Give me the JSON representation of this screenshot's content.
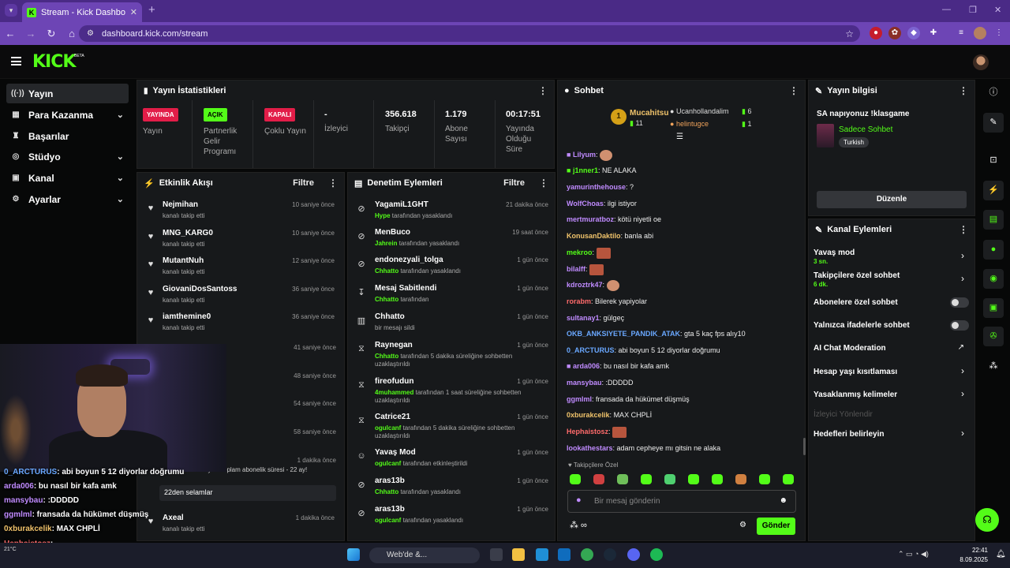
{
  "browser": {
    "tab_title": "Stream - Kick Dashboard",
    "url": "dashboard.kick.com/stream"
  },
  "header": {
    "logo": "KICK",
    "beta": "BETA"
  },
  "sidebar": {
    "items": [
      {
        "label": "Yayın",
        "icon": "broadcast-icon"
      },
      {
        "label": "Para Kazanma",
        "icon": "money-icon"
      },
      {
        "label": "Başarılar",
        "icon": "trophy-icon"
      },
      {
        "label": "Stüdyo",
        "icon": "studio-icon"
      },
      {
        "label": "Kanal",
        "icon": "channel-icon"
      },
      {
        "label": "Ayarlar",
        "icon": "settings-icon"
      }
    ]
  },
  "stats": {
    "title": "Yayın İstatistikleri",
    "live_badge": "YAYINDA",
    "live_label": "Yayın",
    "partner_badge": "AÇIK",
    "partner_label": "Partnerlik Gelir Programı",
    "multi_badge": "KAPALI",
    "multi_label": "Çoklu Yayın",
    "viewers_val": "-",
    "viewers_label": "İzleyici",
    "followers_val": "356.618",
    "followers_label": "Takipçi",
    "subs_val": "1.179",
    "subs_label": "Abone Sayısı",
    "time_val": "00:17:51",
    "time_label": "Yayında Olduğu Süre"
  },
  "activity": {
    "title": "Etkinlik Akışı",
    "filter": "Filtre",
    "rows": [
      {
        "name": "Nejmihan",
        "sub": "kanalı takip etti",
        "time": "10 saniye önce"
      },
      {
        "name": "MNG_KARG0",
        "sub": "kanalı takip etti",
        "time": "10 saniye önce"
      },
      {
        "name": "MutantNuh",
        "sub": "kanalı takip etti",
        "time": "12 saniye önce"
      },
      {
        "name": "GiovaniDosSantoss",
        "sub": "kanalı takip etti",
        "time": "36 saniye önce"
      },
      {
        "name": "iamthemine0",
        "sub": "kanalı takip etti",
        "time": "36 saniye önce"
      }
    ],
    "t6": "41 saniye önce",
    "t7": "48 saniye önce",
    "t8": "54 saniye önce",
    "t9": "58 saniye önce",
    "t10": "1 dakika önce",
    "resub_text": "... yenilendi kutluyor! Toplam abonelik süresi - 22 ay!",
    "resub_msg": "22den selamlar",
    "last_name": "Axeal",
    "last_sub": "kanalı takip etti",
    "last_time": "1 dakika önce"
  },
  "moderation": {
    "title": "Denetim Eylemleri",
    "filter": "Filtre",
    "rows": [
      {
        "name": "YagamiL1GHT",
        "who": "Hype",
        "action": "tarafından yasaklandı",
        "time": "21 dakika önce"
      },
      {
        "name": "MenBuco",
        "who": "Jahrein",
        "action": "tarafından yasaklandı",
        "time": "19 saat önce"
      },
      {
        "name": "endonezyali_tolga",
        "who": "Chhatto",
        "action": "tarafından yasaklandı",
        "time": "1 gün önce"
      },
      {
        "name": "Mesaj Sabitlendi",
        "who": "Chhatto",
        "action": "tarafından",
        "time": "1 gün önce"
      },
      {
        "name": "Chhatto",
        "who": "",
        "action": "bir mesajı sildi",
        "time": "1 gün önce"
      },
      {
        "name": "Raynegan",
        "who": "Chhatto",
        "action": "tarafından 5 dakika süreliğine sohbetten uzaklaştırıldı",
        "time": "1 gün önce"
      },
      {
        "name": "fireofudun",
        "who": "4muhammed",
        "action": "tarafından 1 saat süreliğine sohbetten uzaklaştırıldı",
        "time": "1 gün önce"
      },
      {
        "name": "Catrice21",
        "who": "ogulcanf",
        "action": "tarafından 5 dakika süreliğine sohbetten uzaklaştırıldı",
        "time": "1 gün önce"
      },
      {
        "name": "Yavaş Mod",
        "who": "ogulcanf",
        "action": "tarafından etkinleştirildi",
        "time": "1 gün önce"
      },
      {
        "name": "aras13b",
        "who": "Chhatto",
        "action": "tarafından yasaklandı",
        "time": "1 gün önce"
      },
      {
        "name": "aras13b",
        "who": "ogulcanf",
        "action": "tarafından yasaklandı",
        "time": "1 gün önce"
      }
    ]
  },
  "chat": {
    "title": "Sohbet",
    "top1_name": "Mucahitsu",
    "top1_count": "11",
    "top1_rank": "1",
    "top2_name": "Ucanhollandalim",
    "top2_count": "6",
    "top3_name": "helintugce",
    "top3_count": "1",
    "messages": [
      {
        "user": "Lilyum",
        "text": "",
        "color": "#c08bff"
      },
      {
        "user": "j1nner1",
        "text": "NE ALAKA",
        "color": "#53fc18"
      },
      {
        "user": "yamurinthehouse",
        "text": "?",
        "color": "#c08bff"
      },
      {
        "user": "WolfChoas",
        "text": "ilgi istiyor",
        "color": "#c08bff"
      },
      {
        "user": "mertmuratboz",
        "text": "kötü niyetli oe",
        "color": "#c08bff"
      },
      {
        "user": "KonusanDaktilo",
        "text": "banla abi",
        "color": "#f0c36b"
      },
      {
        "user": "mekroo",
        "text": "",
        "color": "#53fc18"
      },
      {
        "user": "bilalff",
        "text": "",
        "color": "#c08bff"
      },
      {
        "user": "kdroztrk47",
        "text": "",
        "color": "#c08bff"
      },
      {
        "user": "rorabm",
        "text": "Bilerek yapiyolar",
        "color": "#ff6b6b"
      },
      {
        "user": "sultanay1",
        "text": "gülgeç",
        "color": "#c08bff"
      },
      {
        "user": "OKB_ANKSIYETE_PANDIK_ATAK",
        "text": "gta 5 kaç fps alıy10",
        "color": "#6aa8ff"
      },
      {
        "user": "0_ARCTURUS",
        "text": "abi boyun 5 12 diyorlar doğrumu",
        "color": "#6aa8ff"
      },
      {
        "user": "arda006",
        "text": "bu nasıl bir kafa amk",
        "color": "#c08bff"
      },
      {
        "user": "mansybau",
        "text": ":DDDDD",
        "color": "#c08bff"
      },
      {
        "user": "ggmlml",
        "text": "fransada da hükümet düşmüş",
        "color": "#c08bff"
      },
      {
        "user": "0xburakcelik",
        "text": "MAX CHPLİ",
        "color": "#f0c36b"
      },
      {
        "user": "Hephaistosz",
        "text": "",
        "color": "#ff6b6b"
      },
      {
        "user": "lookathestars",
        "text": "adam cepheye mı gitsin ne alaka",
        "color": "#c08bff"
      }
    ],
    "followers_only": "Takipçilere Özel",
    "placeholder": "Bir mesaj gönderin",
    "send": "Gönder"
  },
  "info": {
    "title": "Yayın bilgisi",
    "stream_title": "SA napıyonuz !klasgame",
    "category": "Sadece Sohbet",
    "tag": "Turkish",
    "edit": "Düzenle"
  },
  "channel": {
    "title": "Kanal Eylemleri",
    "slow": "Yavaş mod",
    "slow_sub": "3 sn.",
    "followers": "Takipçilere özel sohbet",
    "followers_sub": "6 dk.",
    "subs": "Abonelere özel sohbet",
    "emotes": "Yalnızca ifadelerle sohbet",
    "ai": "AI Chat Moderation",
    "age": "Hesap yaşı kısıtlaması",
    "banned": "Yasaklanmış kelimeler",
    "viewer_dir": "İzleyici Yönlendir",
    "goals": "Hedefleri belirleyin"
  },
  "overlay": {
    "lines": [
      {
        "u": "0_ARCTURUS",
        "t": ": abi boyun 5 12 diyorlar doğrumu"
      },
      {
        "u": "arda006",
        "t": ": bu nasıl bir kafa amk"
      },
      {
        "u": "mansybau",
        "t": ": :DDDDD"
      },
      {
        "u": "ggmlml",
        "t": ": fransada da hükümet düşmüş"
      },
      {
        "u": "0xburakcelik",
        "t": ": MAX CHPLİ"
      },
      {
        "u": "Hephaistosz",
        "t": ":"
      },
      {
        "u": "lookathestars",
        "t": ": adam cepheye mı gitsin ne alaka"
      }
    ],
    "temp": "21°C"
  },
  "taskbar": {
    "search": "Web'de &...",
    "time": "22:41",
    "date": "8.09.2025"
  },
  "colors": {
    "accent": "#53fc18",
    "live": "#e21d48",
    "panel": "#17191b",
    "chrome": "#6d45b5"
  }
}
